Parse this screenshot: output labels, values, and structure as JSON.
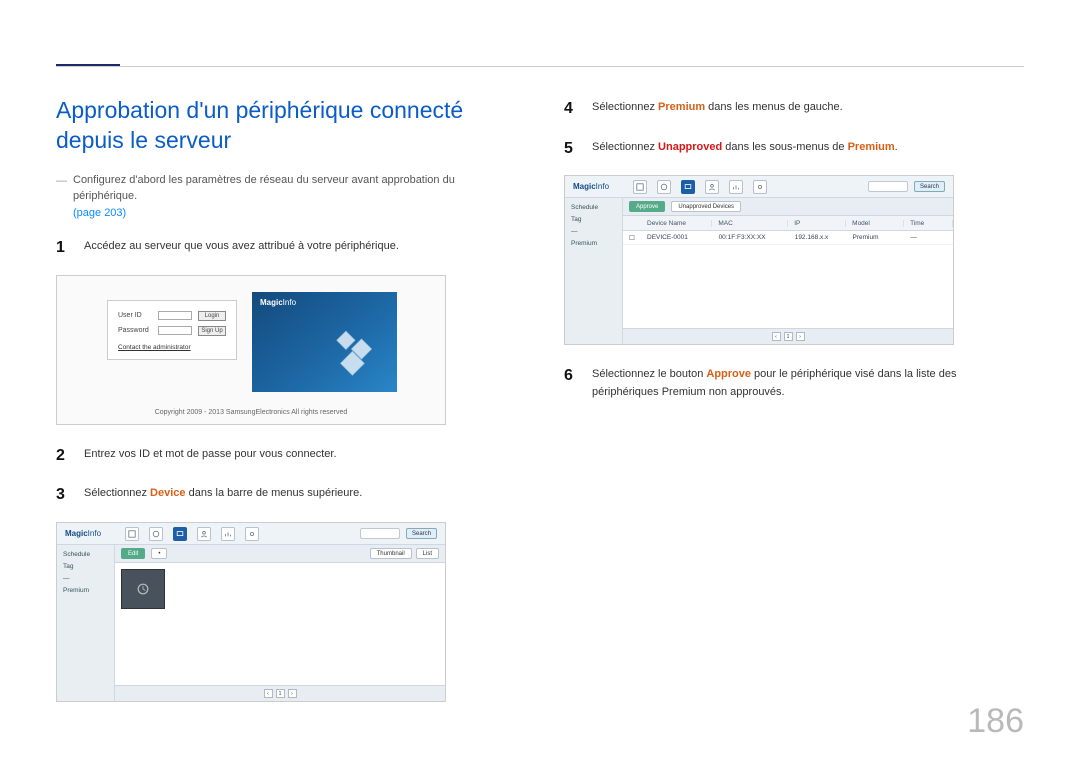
{
  "title": "Approbation d'un périphérique connecté depuis le serveur",
  "intro": {
    "text": "Configurez d'abord les paramètres de réseau du serveur avant approbation du périphérique.",
    "link_label": "(page 203)"
  },
  "steps": {
    "s1": {
      "num": "1",
      "text": "Accédez au serveur que vous avez attribué à votre périphérique."
    },
    "s2": {
      "num": "2",
      "text": "Entrez vos ID et mot de passe pour vous connecter."
    },
    "s3": {
      "num": "3",
      "pre": "Sélectionnez ",
      "accent": "Device",
      "post": " dans la barre de menus supérieure."
    },
    "s4": {
      "num": "4",
      "pre": "Sélectionnez ",
      "accent": "Premium",
      "post": " dans les menus de gauche."
    },
    "s5": {
      "num": "5",
      "pre": "Sélectionnez ",
      "accent": "Unapproved",
      "post": " dans les sous-menus de ",
      "accent2": "Premium",
      "post2": "."
    },
    "s6": {
      "num": "6",
      "pre": "Sélectionnez le bouton ",
      "accent": "Approve",
      "post": " pour le périphérique visé dans la liste des périphériques Premium non approuvés."
    }
  },
  "login_shot": {
    "userid_label": "User ID",
    "password_label": "Password",
    "login_btn": "Login",
    "signup_btn": "Sign Up",
    "contact": "Contact the administrator",
    "copyright": "Copyright 2009 - 2013 SamsungElectronics All rights reserved",
    "brand_strong": "Magic",
    "brand_light": "Info"
  },
  "app_shot": {
    "brand_strong": "Magic",
    "brand_light": "Info",
    "search_btn": "Search",
    "side": {
      "i1": "Schedule",
      "i2": "Tag",
      "i3": "—",
      "i4": "Premium"
    },
    "foot": {
      "p1": "‹",
      "p2": "1",
      "p3": "›"
    },
    "dev_toolbar": {
      "b1": "Edit"
    },
    "dev_toolbar_r": {
      "r1": "Thumbnail",
      "r2": "List"
    },
    "prem_toolbar": {
      "b1": "Approve",
      "b2": "Unapproved Devices"
    },
    "table_head": {
      "c1": " ",
      "c2": "Device Name",
      "c3": "MAC",
      "c4": "IP",
      "c5": "Model",
      "c6": "Time"
    },
    "table_row": {
      "c1": "☐",
      "c2": "DEVICE-0001",
      "c3": "00:1F:F3:XX:XX",
      "c4": "192.168.x.x",
      "c5": "Premium",
      "c6": "—"
    }
  },
  "page_number": "186"
}
